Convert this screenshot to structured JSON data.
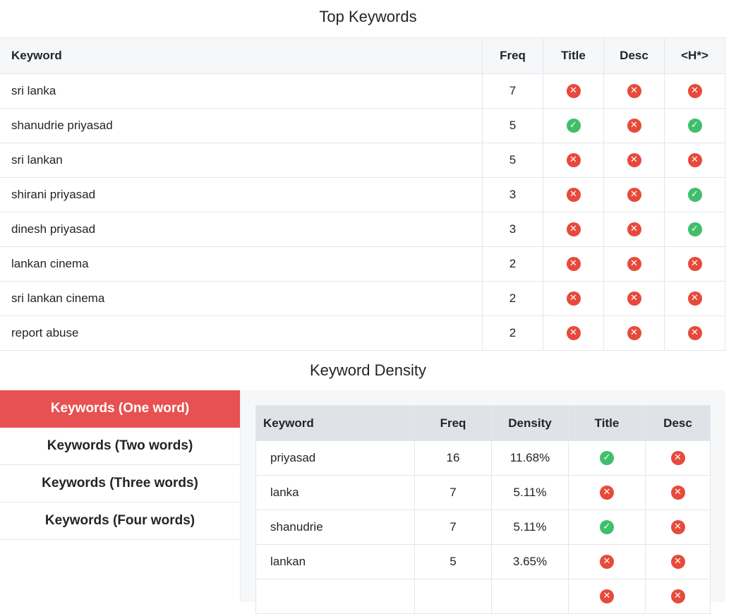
{
  "top_keywords": {
    "title": "Top Keywords",
    "headers": {
      "keyword": "Keyword",
      "freq": "Freq",
      "title": "Title",
      "desc": "Desc",
      "h": "<H*>"
    },
    "rows": [
      {
        "keyword": "sri lanka",
        "freq": "7",
        "title": false,
        "desc": false,
        "h": false
      },
      {
        "keyword": "shanudrie priyasad",
        "freq": "5",
        "title": true,
        "desc": false,
        "h": true
      },
      {
        "keyword": "sri lankan",
        "freq": "5",
        "title": false,
        "desc": false,
        "h": false
      },
      {
        "keyword": "shirani priyasad",
        "freq": "3",
        "title": false,
        "desc": false,
        "h": true
      },
      {
        "keyword": "dinesh priyasad",
        "freq": "3",
        "title": false,
        "desc": false,
        "h": true
      },
      {
        "keyword": "lankan cinema",
        "freq": "2",
        "title": false,
        "desc": false,
        "h": false
      },
      {
        "keyword": "sri lankan cinema",
        "freq": "2",
        "title": false,
        "desc": false,
        "h": false
      },
      {
        "keyword": "report abuse",
        "freq": "2",
        "title": false,
        "desc": false,
        "h": false
      }
    ]
  },
  "density": {
    "title": "Keyword Density",
    "tabs": [
      {
        "label": "Keywords (One word)",
        "active": true
      },
      {
        "label": "Keywords (Two words)",
        "active": false
      },
      {
        "label": "Keywords (Three words)",
        "active": false
      },
      {
        "label": "Keywords (Four words)",
        "active": false
      }
    ],
    "headers": {
      "keyword": "Keyword",
      "freq": "Freq",
      "density": "Density",
      "title": "Title",
      "desc": "Desc"
    },
    "rows": [
      {
        "keyword": "priyasad",
        "freq": "16",
        "density": "11.68%",
        "title": true,
        "desc": false
      },
      {
        "keyword": "lanka",
        "freq": "7",
        "density": "5.11%",
        "title": false,
        "desc": false
      },
      {
        "keyword": "shanudrie",
        "freq": "7",
        "density": "5.11%",
        "title": true,
        "desc": false
      },
      {
        "keyword": "lankan",
        "freq": "5",
        "density": "3.65%",
        "title": false,
        "desc": false
      },
      {
        "keyword": "",
        "freq": "",
        "density": "",
        "title": false,
        "desc": false
      }
    ]
  },
  "icons": {
    "yes": "check-circle-icon",
    "no": "x-circle-icon"
  },
  "colors": {
    "yes": "#3fbf6b",
    "no": "#e74a3b",
    "active_tab": "#e85151"
  }
}
